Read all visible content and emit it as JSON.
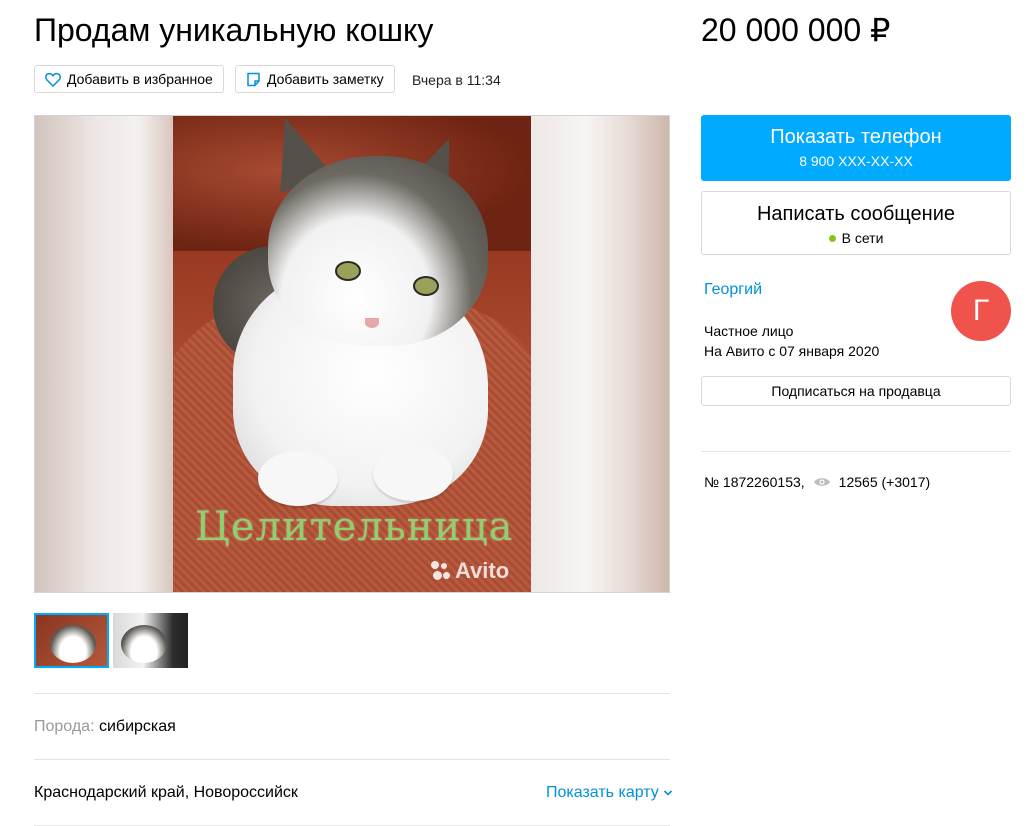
{
  "header": {
    "title": "Продам уникальную кошку",
    "price": "20 000 000 ₽"
  },
  "actions": {
    "favorite_label": "Добавить в избранное",
    "note_label": "Добавить заметку",
    "date": "Вчера в 11:34"
  },
  "gallery": {
    "caption": "Целительница",
    "watermark": "Avito",
    "thumbnail_count": 2,
    "selected_thumbnail": 1
  },
  "params": {
    "breed_key": "Порода:",
    "breed_value": "сибирская"
  },
  "location": {
    "address": "Краснодарский край, Новороссийск",
    "map_link": "Показать карту"
  },
  "contact": {
    "phone_label": "Показать телефон",
    "phone_masked": "8 900 XXX-XX-XX",
    "message_label": "Написать сообщение",
    "online_status": "В сети"
  },
  "seller": {
    "name": "Георгий",
    "avatar_letter": "Г",
    "type": "Частное лицо",
    "since": "На Авито с 07 января 2020",
    "subscribe_label": "Подписаться на продавца"
  },
  "listing_meta": {
    "number": "№ 1872260153,",
    "views": "12565 (+3017)"
  },
  "colors": {
    "accent": "#00aaff",
    "link": "#0091d9",
    "avatar": "#f0524c",
    "online": "#88c41c"
  },
  "icons": [
    "heart-icon",
    "note-icon",
    "eye-icon",
    "chevron-down-icon"
  ]
}
